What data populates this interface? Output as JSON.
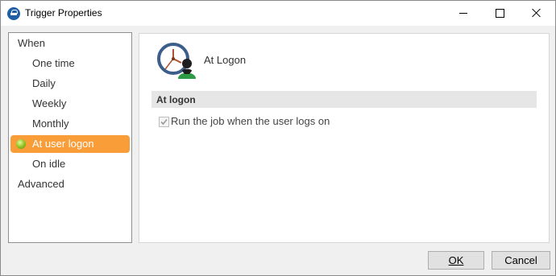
{
  "window": {
    "title": "Trigger Properties"
  },
  "titlebar_icons": {
    "app": "task-icon",
    "minimize": "minimize-icon",
    "maximize": "maximize-icon",
    "close": "close-icon"
  },
  "nav": {
    "when": "When",
    "one_time": "One time",
    "daily": "Daily",
    "weekly": "Weekly",
    "monthly": "Monthly",
    "at_user_logon": "At user logon",
    "on_idle": "On idle",
    "advanced": "Advanced",
    "selected": "At user logon",
    "selected_color": "#f99d39"
  },
  "content": {
    "heading": "At Logon",
    "heading_icon": "clock-user-icon",
    "group_title": "At logon",
    "checkbox_label": "Run the job when the user logs on",
    "checkbox_checked": true,
    "checkbox_enabled": false
  },
  "buttons": {
    "ok": "OK",
    "cancel": "Cancel"
  }
}
